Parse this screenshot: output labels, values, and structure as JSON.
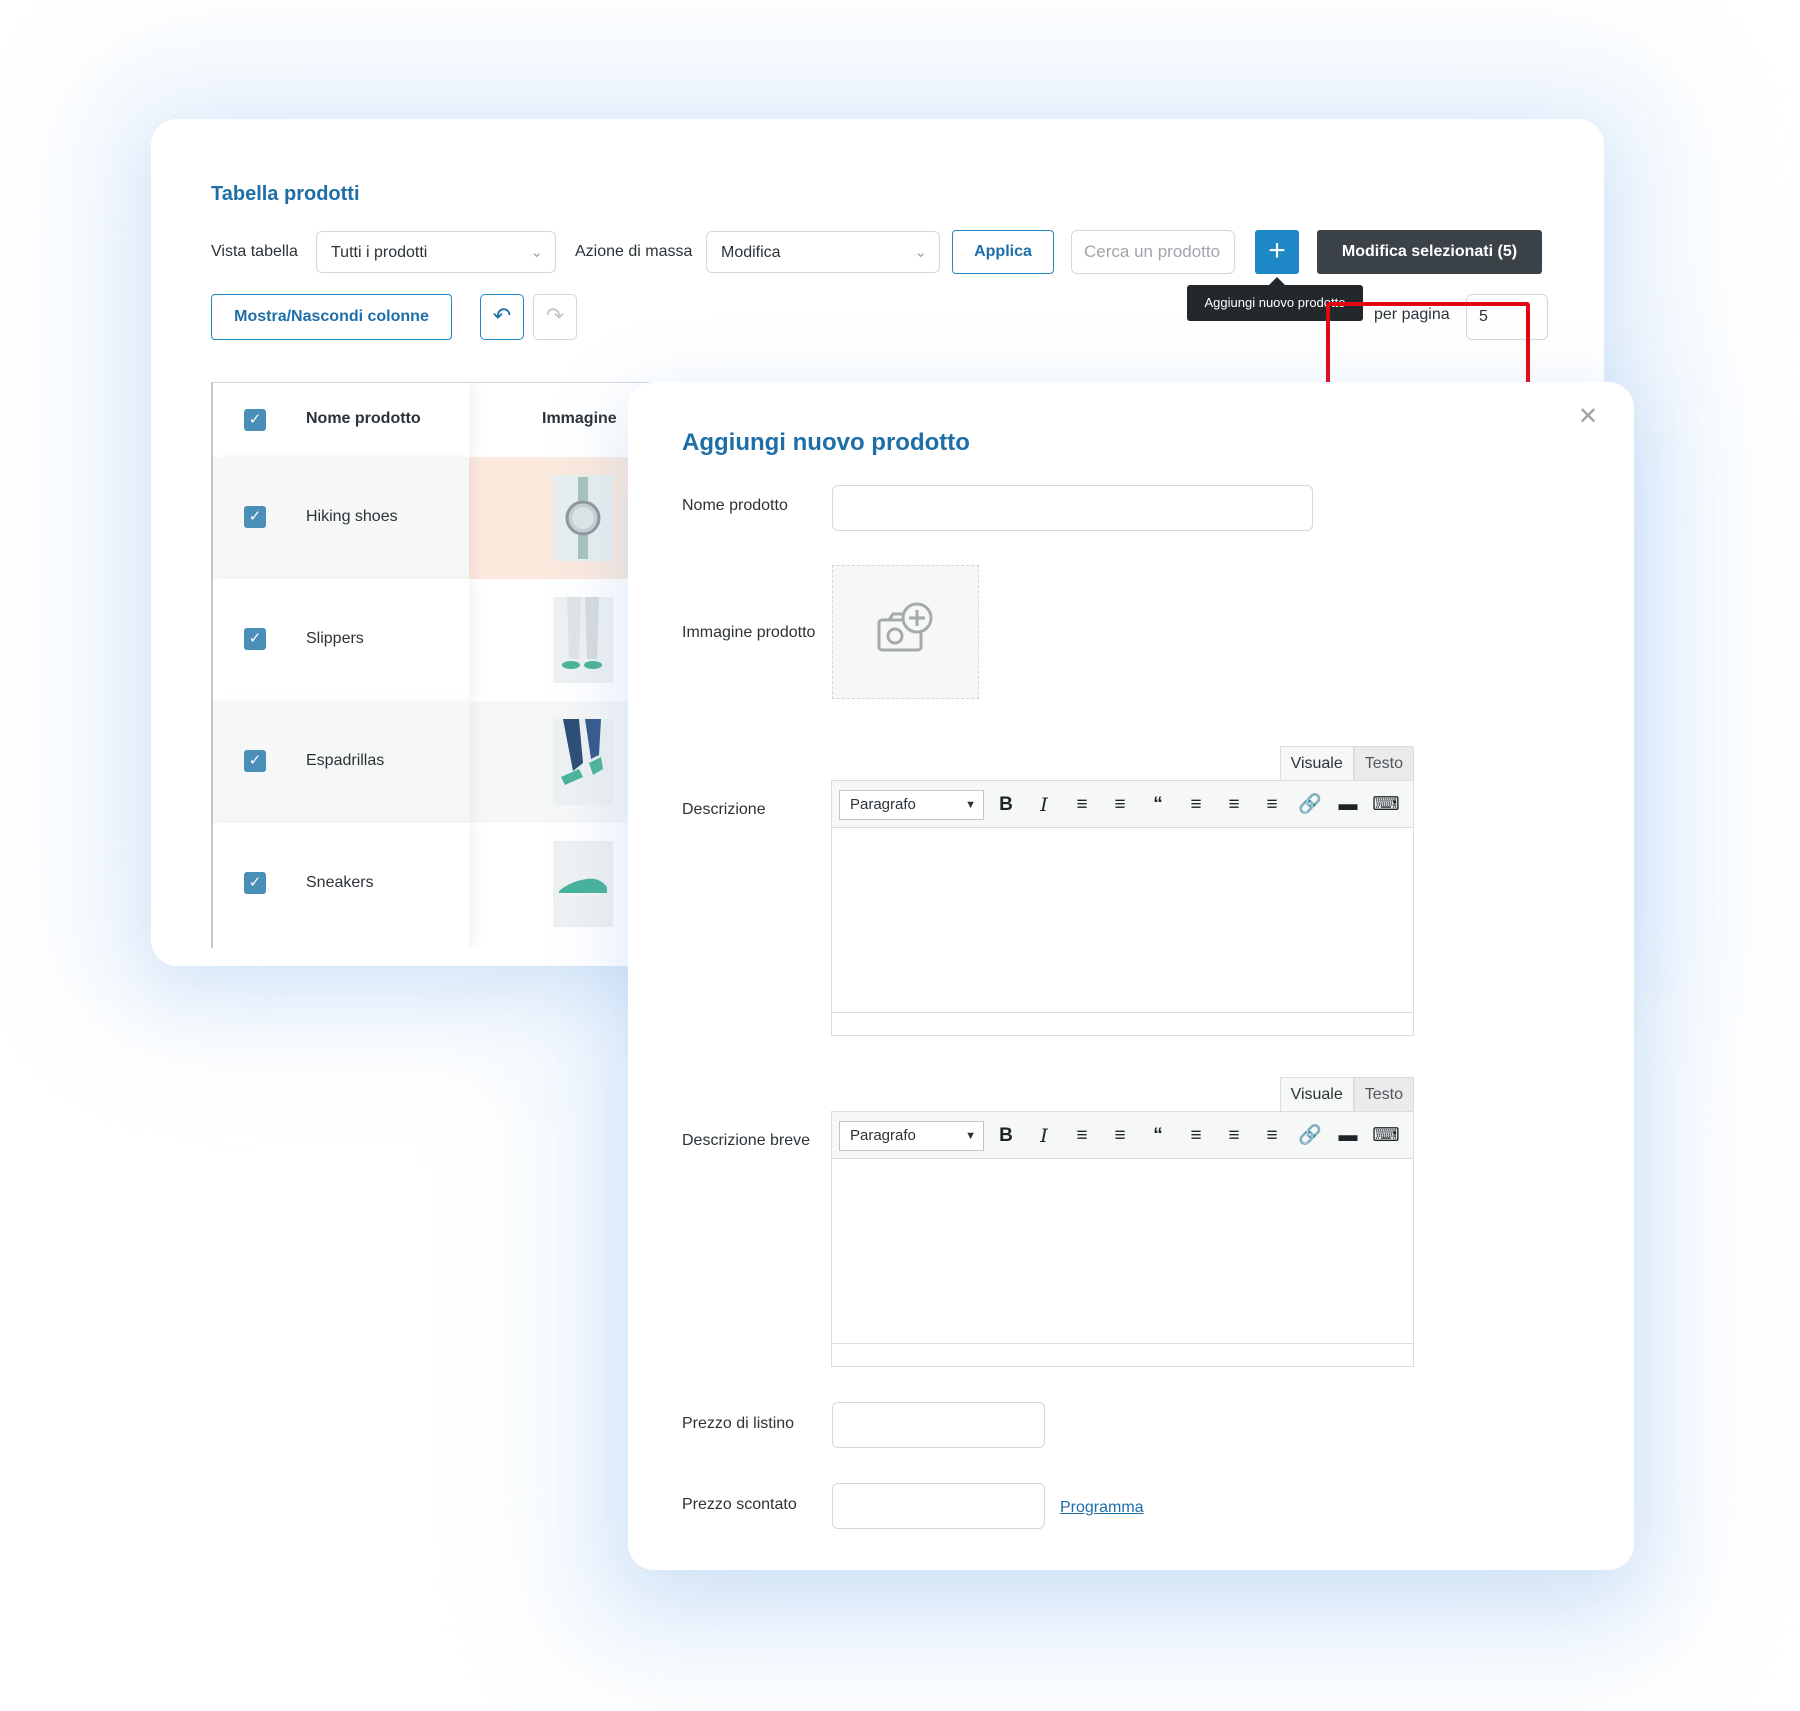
{
  "toolbar": {
    "title": "Tabella prodotti",
    "vista_label": "Vista tabella",
    "vista_value": "Tutti i prodotti",
    "azione_label": "Azione di massa",
    "azione_value": "Modifica",
    "applica": "Applica",
    "search_placeholder": "Cerca un prodotto",
    "add_symbol": "+",
    "edit_selected": "Modifica selezionati (5)",
    "tooltip": "Aggiungi nuovo prodotto",
    "show_hide": "Mostra/Nascondi colonne",
    "per_page_label": "per pagina",
    "per_page_value": "5"
  },
  "table": {
    "headers": [
      "Nome prodotto",
      "Immagine"
    ],
    "rows": [
      {
        "name": "Hiking shoes",
        "image_icon": "watch-thumbnail"
      },
      {
        "name": "Slippers",
        "image_icon": "slippers-thumbnail"
      },
      {
        "name": "Espadrillas",
        "image_icon": "espadrillas-thumbnail"
      },
      {
        "name": "Sneakers",
        "image_icon": "sneakers-thumbnail"
      }
    ]
  },
  "modal": {
    "title": "Aggiungi nuovo prodotto",
    "close_icon": "close-icon",
    "fields": {
      "nome": "Nome prodotto",
      "immagine": "Immagine prodotto",
      "descrizione": "Descrizione",
      "descrizione_breve": "Descrizione breve",
      "prezzo_listino": "Prezzo di listino",
      "prezzo_scontato": "Prezzo scontato"
    },
    "editor": {
      "tab_visual": "Visuale",
      "tab_text": "Testo",
      "format_select": "Paragrafo"
    },
    "schedule_link": "Programma"
  },
  "colors": {
    "accent": "#1e88c7",
    "title": "#1e6fa8",
    "dark_button": "#3c4348",
    "highlight_box": "#e30613",
    "checkbox": "#4a8fb8"
  }
}
